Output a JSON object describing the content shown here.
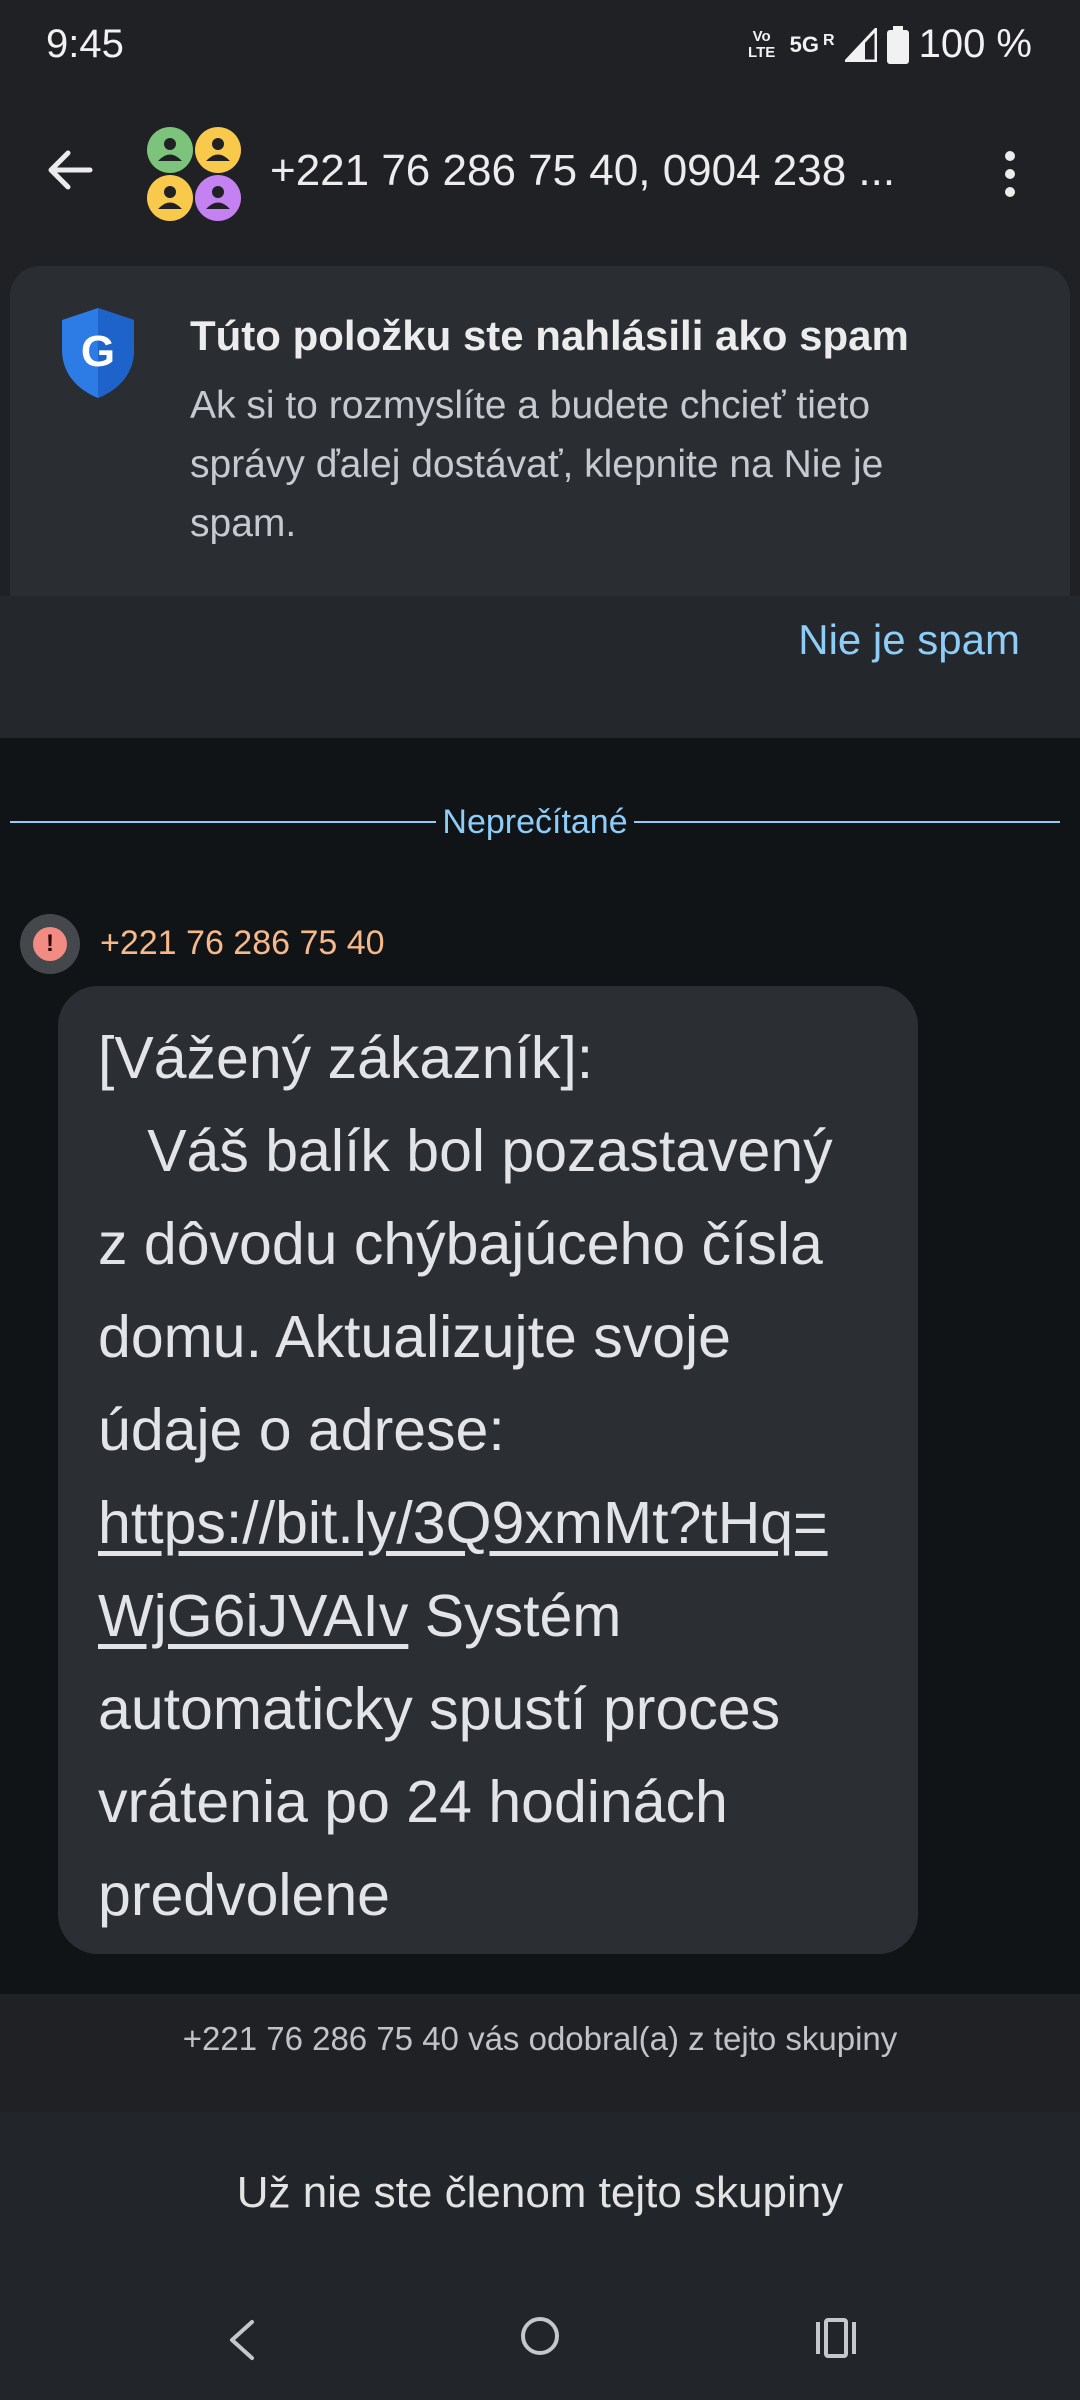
{
  "status_bar": {
    "time": "9:45",
    "volte_top": "Vo",
    "volte_bottom": "LTE",
    "network": "5G",
    "network_sup": "R",
    "battery": "100 %"
  },
  "header": {
    "title": "+221 76 286 75 40, 0904 238 ...",
    "icons": {
      "back": "back-arrow-icon",
      "menu": "more-vert-icon",
      "avatar": "group-avatar-icon"
    }
  },
  "spam_banner": {
    "title": "Túto položku ste nahlásili ako spam",
    "body": "Ak si to rozmyslíte a budete chcieť tieto správy ďalej dostávať, klepnite na Nie je spam.",
    "action": "Nie je spam",
    "icon": "google-shield-icon"
  },
  "divider": {
    "label": "Neprečítané"
  },
  "message": {
    "sender": "+221 76 286 75 40",
    "text_before_link": "[Vážený zákazník]:\n   Váš balík bol pozastavený z dôvodu chýbajúceho čísla domu. Aktualizujte svoje údaje o adrese: ",
    "link_line1": "https://bit.ly/3Q9xmMt?tHq=",
    "link_line2": "WjG6iJVAIv",
    "text_after_link": " Systém automaticky spustí proces vrátenia po 24 hodinách predvolene"
  },
  "system_note": "+221 76 286 75 40 vás odobral(a) z tejto skupiny",
  "footer": {
    "message": "Už nie ste členom tejto skupiny"
  },
  "colors": {
    "accent": "#8ecdf8",
    "sender": "#f6b98b",
    "error": "#f28b82",
    "bubble": "#2b2e33"
  }
}
